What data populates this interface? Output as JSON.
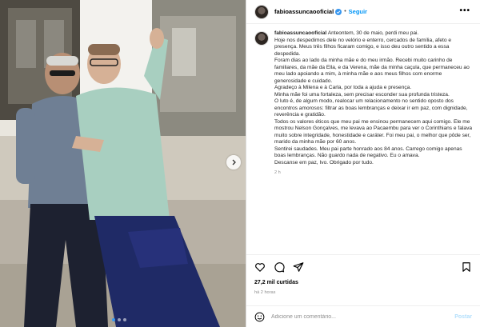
{
  "post": {
    "username": "fabioassuncaooficial",
    "separator": "•",
    "follow_label": "Seguir",
    "more_label": "•••"
  },
  "caption": {
    "username": "fabioassuncaooficial",
    "paragraphs": [
      "Anteontem, 30 de maio, perdi meu pai.",
      "Hoje nos despedimos dele no velório e enterro, cercados de família, afeto e presença. Meus três filhos ficaram comigo, e isso deu outro sentido a essa despedida.",
      "Foram dias ao lado da minha mãe e do meu irmão. Recebi muito carinho de familiares, da mãe da Ella, e da Verena, mãe da minha caçula, que permaneceu ao meu lado apoiando a mim, à minha mãe e aos meus filhos com enorme generosidade e cuidado.",
      "Agradeço à Milena e à Carla, por toda a ajuda e presença.",
      "Minha mãe foi uma fortaleza, sem precisar esconder sua profunda tristeza.",
      "O luto é, de algum modo, realocar um relacionamento no sentido oposto dos encontros amorosos: filtrar as boas lembranças e deixar ir em paz, com dignidade, reverência e gratidão.",
      "Todos os valores éticos que meu pai me ensinou permanecem aqui comigo. Ele me mostrou Nelson Gonçalves, me levava ao Pacaembu para ver o Corinthians e falava muito sobre integridade, honestidade e caráter. Foi meu pai, o melhor que pôde ser, marido da minha mãe por 60 anos.",
      "Sentirei saudades. Meu pai parte honrado aos 84 anos. Carrego comigo apenas boas lembranças. Não guardo nada de negativo. Eu o amava.",
      "Descanse em paz, Ivo. Obrigado por tudo."
    ],
    "time_ago": "2 h"
  },
  "stats": {
    "likes": "27,2 mil curtidas",
    "posted": "há 2 horas"
  },
  "comment": {
    "placeholder": "Adicione um comentário...",
    "publish_label": "Postar"
  },
  "icons": {
    "verified": "verified-badge-icon",
    "like": "heart-icon",
    "comment": "comment-bubble-icon",
    "share": "paper-plane-icon",
    "save": "bookmark-icon",
    "emoji": "smiley-icon",
    "next": "chevron-right-icon"
  },
  "colors": {
    "accent": "#0095f6",
    "verified": "#3897f0",
    "muted": "#8e8e8e"
  },
  "carousel": {
    "total_slides": 3,
    "active_slide": 1
  }
}
